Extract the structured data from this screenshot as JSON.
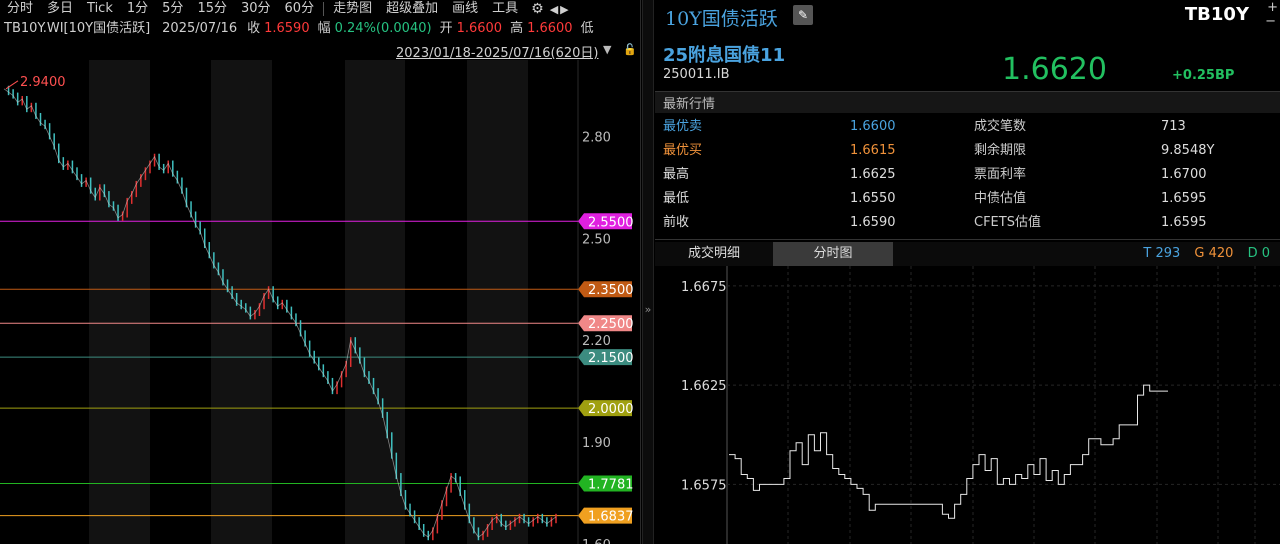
{
  "toolbar": {
    "items": [
      "分时",
      "多日",
      "Tick",
      "1分",
      "5分",
      "15分",
      "30分",
      "60分"
    ],
    "items2": [
      "走势图",
      "超级叠加",
      "画线",
      "工具"
    ],
    "gear_icon": "gear-icon",
    "nav_arrows": "◀▶"
  },
  "quote": {
    "symbol": "TB10Y.WI[10Y国债活跃]",
    "date": "2025/07/16",
    "close_label": "收",
    "close": "1.6590",
    "change_label": "幅",
    "change": "0.24%(0.0040)",
    "open_label": "开",
    "open": "1.6600",
    "high_label": "高",
    "high": "1.6600",
    "low_label": "低"
  },
  "range": "2023/01/18-2025/07/16(620日)",
  "left_chart": {
    "y_ticks": [
      "2.80",
      "2.50",
      "2.20",
      "1.90",
      "1.60"
    ],
    "max_label": "2.9400",
    "levels": [
      {
        "label": "2.5500",
        "value": 2.55,
        "color": "#e020e0"
      },
      {
        "label": "2.3500",
        "value": 2.35,
        "color": "#c05a14"
      },
      {
        "label": "2.2500",
        "value": 2.25,
        "color": "#f08888"
      },
      {
        "label": "2.1500",
        "value": 2.15,
        "color": "#3c8c80"
      },
      {
        "label": "2.0000",
        "value": 2.0,
        "color": "#a0a010"
      },
      {
        "label": "1.7781",
        "value": 1.7781,
        "color": "#22b422"
      },
      {
        "label": "1.6837",
        "value": 1.6837,
        "color": "#f0a020"
      }
    ],
    "series": [
      2.94,
      2.93,
      2.92,
      2.9,
      2.91,
      2.88,
      2.89,
      2.86,
      2.84,
      2.83,
      2.8,
      2.77,
      2.73,
      2.71,
      2.72,
      2.7,
      2.68,
      2.66,
      2.67,
      2.64,
      2.62,
      2.65,
      2.63,
      2.6,
      2.59,
      2.56,
      2.57,
      2.61,
      2.63,
      2.66,
      2.68,
      2.7,
      2.72,
      2.74,
      2.71,
      2.7,
      2.72,
      2.69,
      2.67,
      2.64,
      2.6,
      2.57,
      2.54,
      2.52,
      2.48,
      2.45,
      2.42,
      2.4,
      2.37,
      2.35,
      2.33,
      2.31,
      2.3,
      2.29,
      2.27,
      2.28,
      2.3,
      2.33,
      2.35,
      2.32,
      2.3,
      2.31,
      2.29,
      2.27,
      2.25,
      2.22,
      2.19,
      2.16,
      2.14,
      2.12,
      2.1,
      2.08,
      2.05,
      2.07,
      2.1,
      2.13,
      2.2,
      2.17,
      2.14,
      2.1,
      2.08,
      2.05,
      2.02,
      1.98,
      1.92,
      1.86,
      1.8,
      1.75,
      1.71,
      1.69,
      1.67,
      1.65,
      1.63,
      1.62,
      1.64,
      1.68,
      1.72,
      1.76,
      1.8,
      1.79,
      1.75,
      1.71,
      1.67,
      1.64,
      1.62,
      1.63,
      1.65,
      1.67,
      1.68,
      1.66,
      1.65,
      1.66,
      1.67,
      1.68,
      1.67,
      1.66,
      1.67,
      1.68,
      1.67,
      1.66,
      1.67,
      1.68
    ],
    "ylim": [
      1.6,
      2.96
    ]
  },
  "right": {
    "title": "10Y国债活跃",
    "edit_icon": "pencil-icon",
    "code": "TB10Y",
    "plus_icon": "+",
    "minus_icon": "−",
    "bond_name": "25附息国债11",
    "bond_code": "250011.IB",
    "price": "1.6620",
    "bp": "+0.25BP",
    "section": "最新行情",
    "rows": [
      {
        "k1": "最优卖",
        "v1": "1.6600",
        "k2": "成交笔数",
        "v2": "713"
      },
      {
        "k1": "最优买",
        "v1": "1.6615",
        "k2": "剩余期限",
        "v2": "9.8548Y"
      },
      {
        "k1": "最高",
        "v1": "1.6625",
        "k2": "票面利率",
        "v2": "1.6700"
      },
      {
        "k1": "最低",
        "v1": "1.6550",
        "k2": "中债估值",
        "v2": "1.6595"
      },
      {
        "k1": "前收",
        "v1": "1.6590",
        "k2": "CFETS估值",
        "v2": "1.6595"
      }
    ],
    "tabs": [
      "成交明细",
      "分时图"
    ],
    "counts": {
      "t": "T 293",
      "g": "G 420",
      "d": "D 0"
    }
  },
  "tick_chart": {
    "y_ticks": [
      "1.6675",
      "1.6625",
      "1.6575"
    ],
    "ylim": [
      1.6545,
      1.6685
    ],
    "series": [
      1.659,
      1.6588,
      1.658,
      1.6578,
      1.6572,
      1.6575,
      1.6575,
      1.6575,
      1.6575,
      1.6578,
      1.6592,
      1.6596,
      1.6585,
      1.66,
      1.6592,
      1.6601,
      1.659,
      1.6583,
      1.658,
      1.6578,
      1.6575,
      1.6573,
      1.657,
      1.6562,
      1.6565,
      1.6565,
      1.6565,
      1.6565,
      1.6565,
      1.6565,
      1.6565,
      1.6565,
      1.6565,
      1.6565,
      1.6565,
      1.656,
      1.6558,
      1.6565,
      1.657,
      1.6578,
      1.6585,
      1.659,
      1.6582,
      1.6588,
      1.6575,
      1.6578,
      1.6575,
      1.658,
      1.6578,
      1.6585,
      1.658,
      1.6588,
      1.6577,
      1.6582,
      1.6575,
      1.658,
      1.6585,
      1.6585,
      1.659,
      1.6598,
      1.6598,
      1.6595,
      1.6595,
      1.6598,
      1.6605,
      1.6605,
      1.6605,
      1.662,
      1.6625,
      1.6622,
      1.6622,
      1.6622,
      1.6622
    ]
  }
}
